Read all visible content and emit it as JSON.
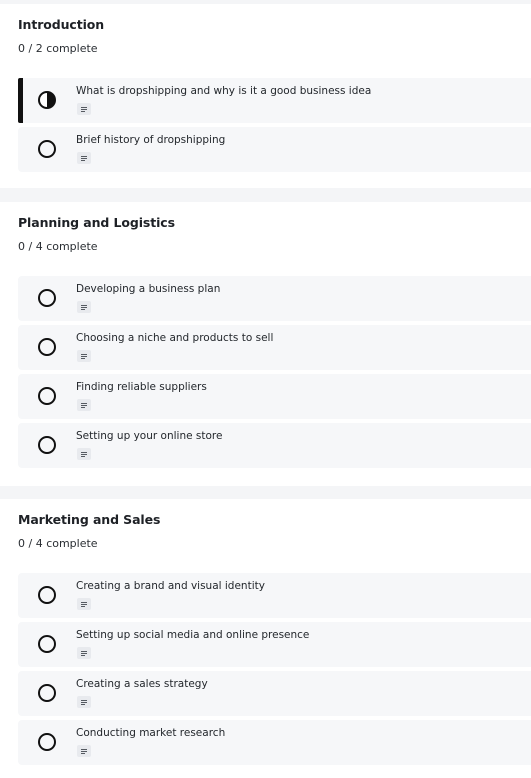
{
  "sections": [
    {
      "title": "Introduction",
      "progress": "0 / 2 complete",
      "lessons": [
        {
          "title": "What is dropshipping and why is it a good business idea",
          "status": "in-progress",
          "type_icon": "document-icon"
        },
        {
          "title": "Brief history of dropshipping",
          "status": "not-started",
          "type_icon": "document-icon"
        }
      ]
    },
    {
      "title": "Planning and Logistics",
      "progress": "0 / 4 complete",
      "lessons": [
        {
          "title": "Developing a business plan",
          "status": "not-started",
          "type_icon": "document-icon"
        },
        {
          "title": "Choosing a niche and products to sell",
          "status": "not-started",
          "type_icon": "document-icon"
        },
        {
          "title": "Finding reliable suppliers",
          "status": "not-started",
          "type_icon": "document-icon"
        },
        {
          "title": "Setting up your online store",
          "status": "not-started",
          "type_icon": "document-icon"
        }
      ]
    },
    {
      "title": "Marketing and Sales",
      "progress": "0 / 4 complete",
      "lessons": [
        {
          "title": "Creating a brand and visual identity",
          "status": "not-started",
          "type_icon": "document-icon"
        },
        {
          "title": "Setting up social media and online presence",
          "status": "not-started",
          "type_icon": "document-icon"
        },
        {
          "title": "Creating a sales strategy",
          "status": "not-started",
          "type_icon": "document-icon"
        },
        {
          "title": "Conducting market research",
          "status": "not-started",
          "type_icon": "document-icon"
        }
      ]
    }
  ],
  "colors": {
    "active_indicator": "#111111",
    "lesson_bg": "#f6f7f9",
    "page_bg": "#f4f5f7"
  }
}
